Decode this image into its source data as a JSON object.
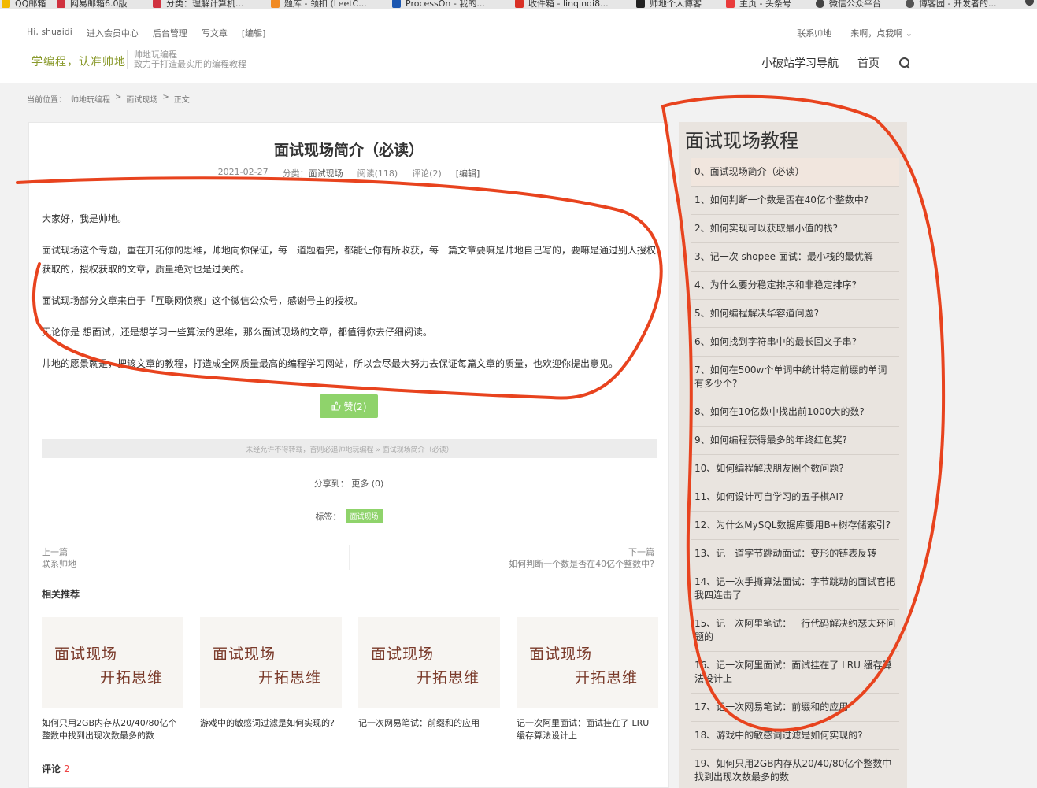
{
  "bookmarks": [
    {
      "label": "QQ邮箱",
      "color": "#f2b800"
    },
    {
      "label": "网易邮箱6.0版",
      "color": "#d0323f"
    },
    {
      "label": "分类：理解计算机...",
      "color": "#d0323f"
    },
    {
      "label": "题库 - 领扣 (LeetC...",
      "color": "#f08a24"
    },
    {
      "label": "ProcessOn - 我的...",
      "color": "#1a56b0"
    },
    {
      "label": "收件箱 - linqindi8...",
      "color": "#d93025"
    },
    {
      "label": "帅地个人博客",
      "color": "#222222"
    },
    {
      "label": "主页 - 头条号",
      "color": "#e93b3b"
    },
    {
      "label": "微信公众平台",
      "color": "#444444"
    },
    {
      "label": "博客园 - 开发者的...",
      "color": "#555555"
    }
  ],
  "header": {
    "greeting": "Hi, shuaidi",
    "links": [
      "进入会员中心",
      "后台管理",
      "写文章",
      "[编辑]"
    ],
    "right_links": [
      "联系帅地",
      "来啊，点我啊 ⌄"
    ],
    "logo": "学编程，认准帅地",
    "tagline_1": "帅地玩编程",
    "tagline_2": "致力于打造最实用的编程教程",
    "nav": [
      "小破站学习导航",
      "首页"
    ]
  },
  "breadcrumb": {
    "prefix": "当前位置：",
    "items": [
      "帅地玩编程",
      ">",
      "面试现场",
      ">",
      "正文"
    ]
  },
  "article": {
    "title": "面试现场简介（必读）",
    "date": "2021-02-27",
    "category_label": "分类：",
    "category": "面试现场",
    "reads": "阅读(118)",
    "comments": "评论(2)",
    "edit": "[编辑]",
    "paragraphs": [
      "大家好，我是帅地。",
      "面试现场这个专题，重在开拓你的思维，帅地向你保证，每一道题看完，都能让你有所收获，每一篇文章要嘛是帅地自己写的，要嘛是通过别人授权获取的，授权获取的文章，质量绝对也是过关的。",
      "面试现场部分文章来自于「互联网侦察」这个微信公众号，感谢号主的授权。",
      "无论你是 想面试，还是想学习一些算法的思维，那么面试现场的文章，都值得你去仔细阅读。",
      "帅地的愿景就是，把该文章的教程，打造成全网质量最高的编程学习网站，所以会尽最大努力去保证每篇文章的质量，也欢迎你提出意见。"
    ],
    "like_label": "赞(2)",
    "notice": "未经允许不得转载，否则必追帅地玩编程 » 面试现场简介（必读）",
    "share_label": "分享到：",
    "share_more": "更多 (0)",
    "tags_label": "标签：",
    "tag": "面试现场",
    "prev_label": "上一篇",
    "prev_title": "联系帅地",
    "next_label": "下一篇",
    "next_title": "如何判断一个数是否在40亿个整数中?",
    "related_heading": "相关推荐",
    "related_thumb_line1": "面试现场",
    "related_thumb_line2": "开拓思维",
    "related": [
      "如何只用2GB内存从20/40/80亿个整数中找到出现次数最多的数",
      "游戏中的敏感词过滤是如何实现的?",
      "记一次网易笔试：前缀和的应用",
      "记一次阿里面试：面试挂在了 LRU 缓存算法设计上"
    ],
    "comments_heading": "评论",
    "comments_count": "2"
  },
  "sidebar": {
    "title": "面试现场教程",
    "items": [
      "0、面试现场简介（必读）",
      "1、如何判断一个数是否在40亿个整数中?",
      "2、如何实现可以获取最小值的栈?",
      "3、记一次 shopee 面试：最小栈的最优解",
      "4、为什么要分稳定排序和非稳定排序?",
      "5、如何编程解决华容道问题?",
      "6、如何找到字符串中的最长回文子串?",
      "7、如何在500w个单词中统计特定前缀的单词有多少个?",
      "8、如何在10亿数中找出前1000大的数?",
      "9、如何编程获得最多的年终红包奖?",
      "10、如何编程解决朋友圈个数问题?",
      "11、如何设计可自学习的五子棋AI?",
      "12、为什么MySQL数据库要用B+树存储索引?",
      "13、记一道字节跳动面试：变形的链表反转",
      "14、记一次手撕算法面试：字节跳动的面试官把我四连击了",
      "15、记一次阿里笔试：一行代码解决约瑟夫环问题的",
      "16、记一次阿里面试：面试挂在了 LRU 缓存算法设计上",
      "17、记一次网易笔试：前缀和的应用",
      "18、游戏中的敏感词过滤是如何实现的?",
      "19、如何只用2GB内存从20/40/80亿个整数中找到出现次数最多的数"
    ]
  },
  "colors": {
    "scribble": "#e8431e",
    "accent_green": "#8fd36b",
    "logo_green": "#8a9a2c"
  }
}
